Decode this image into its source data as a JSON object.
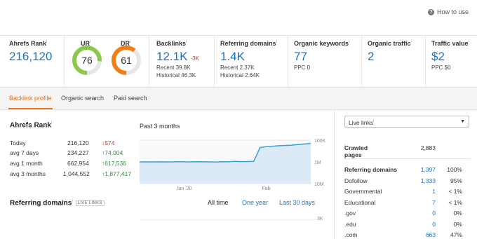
{
  "header": {
    "help_label": "How to use"
  },
  "metrics": {
    "ahrefs_rank": {
      "label": "Ahrefs Rank",
      "value": "216,120"
    },
    "ur": {
      "label": "UR",
      "value": "76",
      "percent": 76,
      "color": "#8cc84b"
    },
    "dr": {
      "label": "DR",
      "value": "61",
      "percent": 61,
      "color": "#f07e1a"
    },
    "backlinks": {
      "label": "Backlinks",
      "value": "12.1K",
      "delta": "-3K",
      "recent": "Recent 39.8K",
      "historical": "Historical 46.3K"
    },
    "referring_domains": {
      "label": "Referring domains",
      "value": "1.4K",
      "recent": "Recent 2.37K",
      "historical": "Historical 2.64K"
    },
    "organic_keywords": {
      "label": "Organic keywords",
      "value": "77",
      "ppc": "PPC 0"
    },
    "organic_traffic": {
      "label": "Organic traffic",
      "value": "2"
    },
    "traffic_value": {
      "label": "Traffic value",
      "value": "$2",
      "ppc": "PPC $0"
    }
  },
  "tabs": [
    {
      "label": "Backlink profile",
      "active": true
    },
    {
      "label": "Organic search",
      "active": false
    },
    {
      "label": "Paid search",
      "active": false
    }
  ],
  "rank_section": {
    "title": "Ahrefs Rank",
    "rows": [
      {
        "label": "Today",
        "value": "216,120",
        "change": "↓574",
        "dir": "down"
      },
      {
        "label": "avg 7 days",
        "value": "234,227",
        "change": "↑74,004",
        "dir": "up"
      },
      {
        "label": "avg 1 month",
        "value": "662,954",
        "change": "↑617,536",
        "dir": "up"
      },
      {
        "label": "avg 3 months",
        "value": "1,044,552",
        "change": "↑1,877,417",
        "dir": "up"
      }
    ]
  },
  "chart_data": {
    "type": "area",
    "title": "Past 3 months",
    "x": [
      "Jan '20",
      "Feb"
    ],
    "y_ticks": [
      "100K",
      "1M",
      "10M"
    ],
    "scale": "log-inverted",
    "series": [
      {
        "values": [
          1000000,
          1000000,
          1000000,
          990000,
          1000000,
          1000000,
          980000,
          990000,
          1000000,
          980000,
          990000,
          1000000,
          1010000,
          980000,
          990000,
          950000,
          970000,
          960000,
          950000,
          220000,
          200000,
          190000,
          180000,
          175000,
          170000,
          160000,
          150000,
          140000
        ]
      }
    ],
    "line_color": "#3aa0d8",
    "fill_color": "#dbeaf6"
  },
  "referring_section": {
    "title": "Referring domains",
    "badge": "LIVE LINKS",
    "periods": [
      "All time",
      "One year",
      "Last 30 days"
    ],
    "y_tick": "3K"
  },
  "right_panel": {
    "select_value": "Live links",
    "crawled": {
      "label": "Crawled pages",
      "value": "2,883"
    },
    "rows": [
      {
        "label": "Referring domains",
        "v1": "1,397",
        "v2": "100%",
        "bold": true
      },
      {
        "label": "Dofollow",
        "v1": "1,333",
        "v2": "95%",
        "bold": false
      },
      {
        "label": "Governmental",
        "v1": "1",
        "v2": "< 1%",
        "bold": false
      },
      {
        "label": "Educational",
        "v1": "7",
        "v2": "< 1%",
        "bold": false
      },
      {
        "label": ".gov",
        "v1": "0",
        "v2": "0%",
        "bold": false
      },
      {
        "label": ".edu",
        "v1": "0",
        "v2": "0%",
        "bold": false
      },
      {
        "label": ".com",
        "v1": "663",
        "v2": "47%",
        "bold": false
      }
    ]
  }
}
